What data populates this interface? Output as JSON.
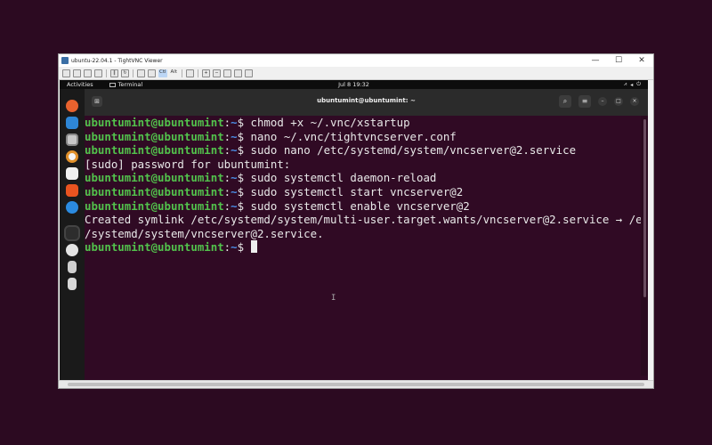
{
  "viewer": {
    "title": "ubuntu-22.04.1 - TightVNC Viewer",
    "controls": {
      "minimize": "—",
      "maximize": "☐",
      "close": "✕"
    },
    "toolbar": {
      "ctrl_label": "Ctl",
      "alt_label": "Alt"
    }
  },
  "desktop": {
    "activities": "Activities",
    "app_name": "Terminal",
    "clock": "Jul 8  19:32"
  },
  "terminal": {
    "title": "ubuntumint@ubuntumint: ~",
    "lines": [
      {
        "user": "ubuntumint@ubuntumint",
        "path": "~",
        "cmd": "chmod +x ~/.vnc/xstartup"
      },
      {
        "user": "ubuntumint@ubuntumint",
        "path": "~",
        "cmd": "nano ~/.vnc/tightvncserver.conf"
      },
      {
        "user": "ubuntumint@ubuntumint",
        "path": "~",
        "cmd": "sudo nano /etc/systemd/system/vncserver@2.service"
      },
      {
        "text": "[sudo] password for ubuntumint:"
      },
      {
        "user": "ubuntumint@ubuntumint",
        "path": "~",
        "cmd": "sudo systemctl daemon-reload"
      },
      {
        "user": "ubuntumint@ubuntumint",
        "path": "~",
        "cmd": "sudo systemctl start vncserver@2"
      },
      {
        "user": "ubuntumint@ubuntumint",
        "path": "~",
        "cmd": "sudo systemctl enable vncserver@2"
      },
      {
        "text": "Created symlink /etc/systemd/system/multi-user.target.wants/vncserver@2.service → /etc"
      },
      {
        "text": "/systemd/system/vncserver@2.service."
      },
      {
        "user": "ubuntumint@ubuntumint",
        "path": "~",
        "cmd": "",
        "cursor": true
      }
    ]
  },
  "colors": {
    "terminal_bg": "#300a24",
    "prompt_user": "#52c24c",
    "prompt_path": "#4a8ee6"
  }
}
